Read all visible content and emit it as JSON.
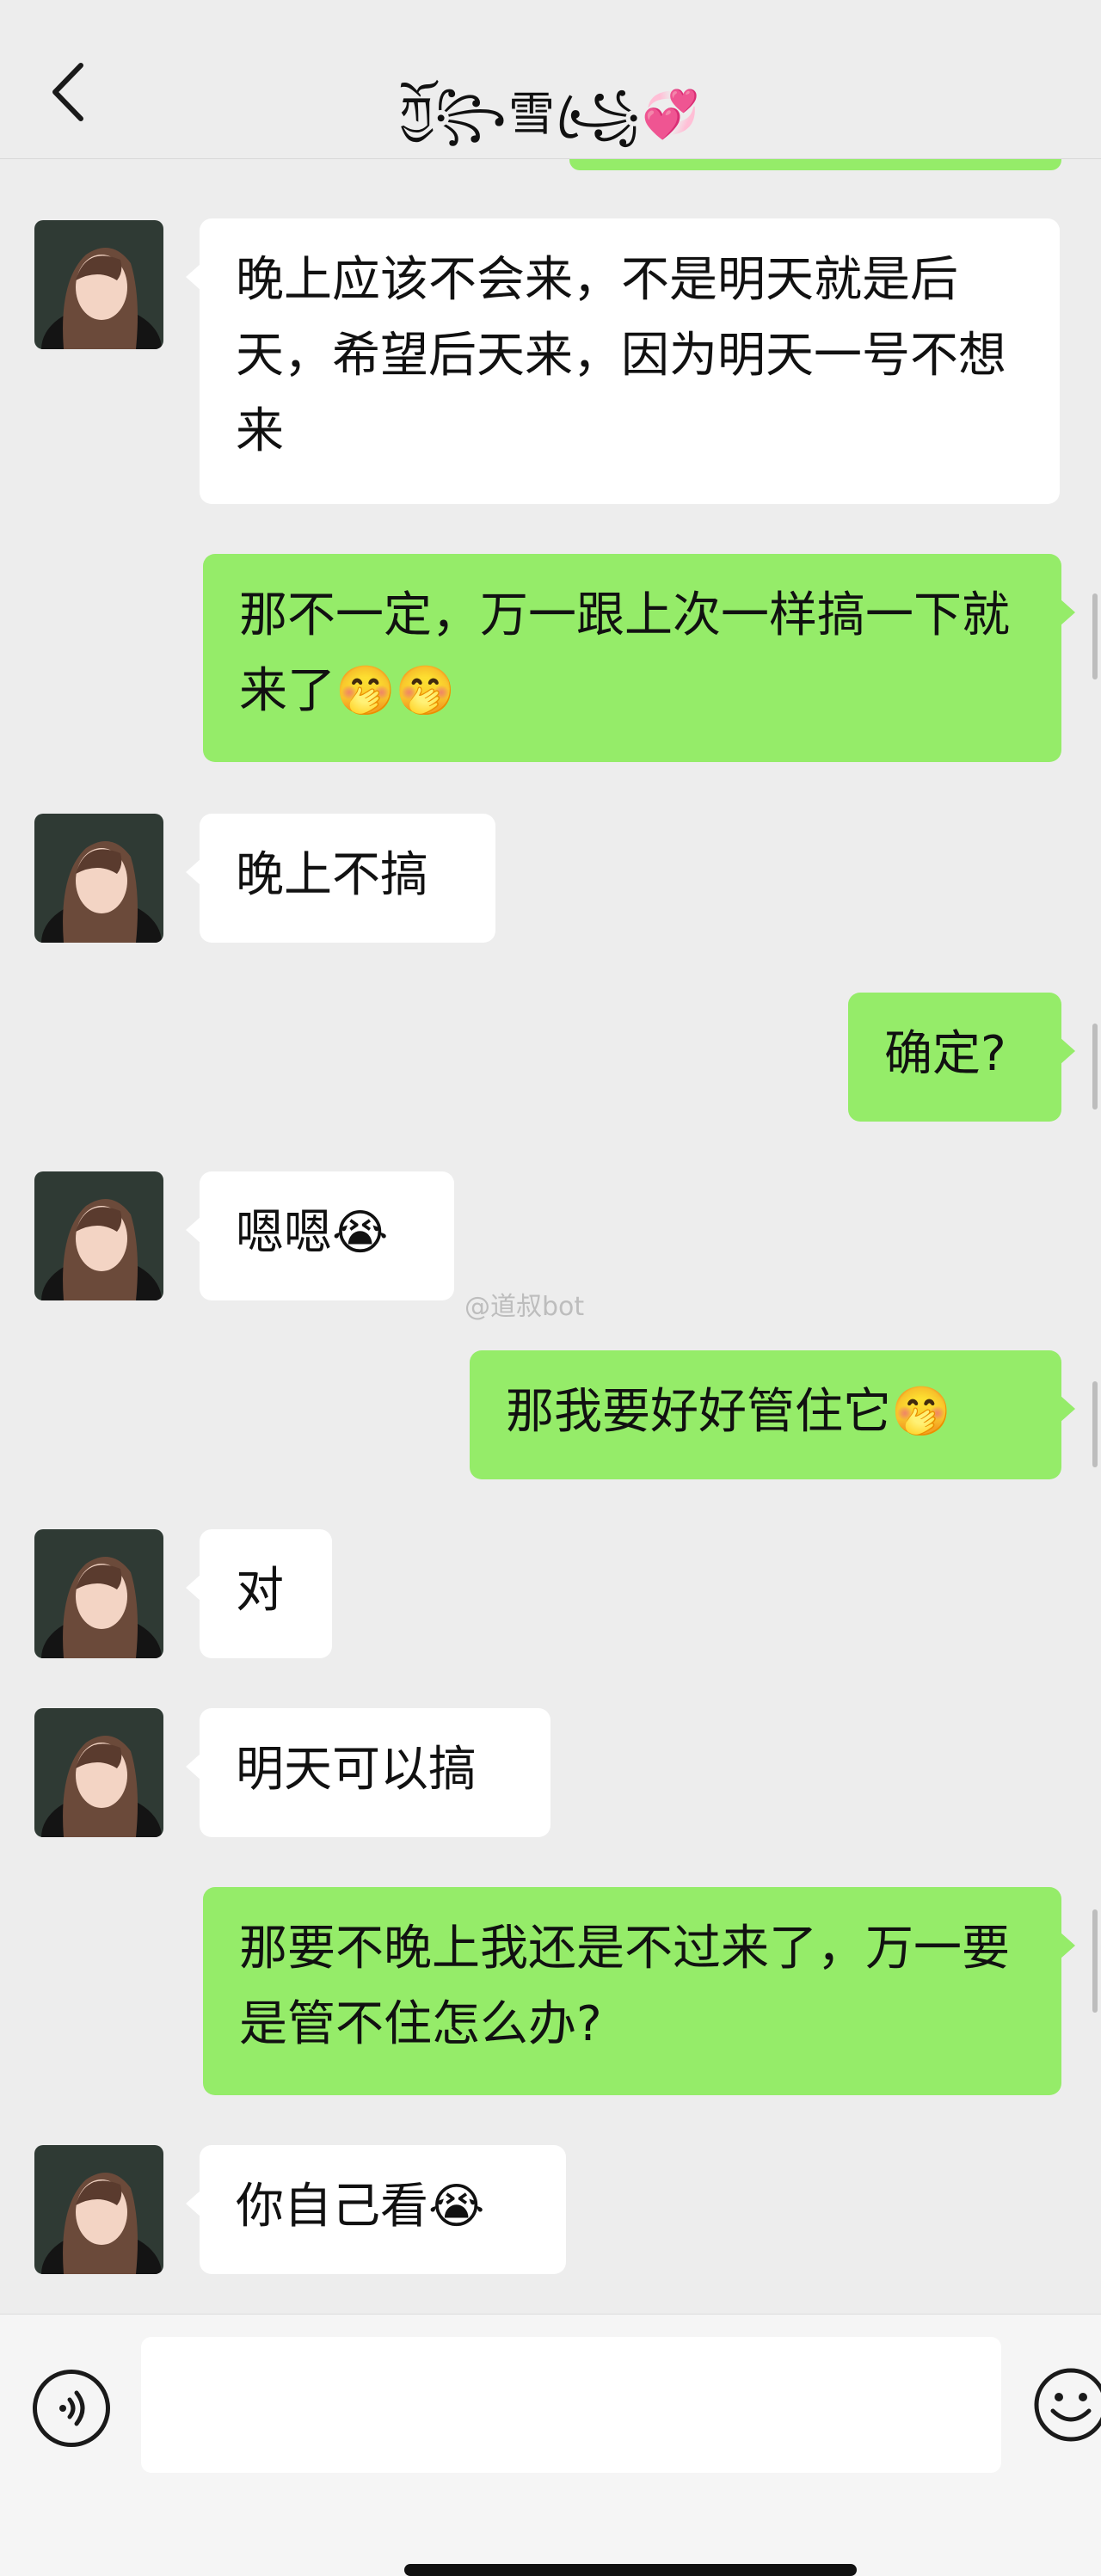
{
  "header": {
    "title": "ཀྱོ꧂雪꧁ꦿ💞"
  },
  "messages": [
    {
      "side": "left",
      "text": "晚上应该不会来，不是明天就是后天，希望后天来，因为明天一号不想来"
    },
    {
      "side": "right",
      "text": "那不一定，万一跟上次一样搞一下就来了🤭🤭"
    },
    {
      "side": "left",
      "text": "晚上不搞"
    },
    {
      "side": "right",
      "text": "确定?"
    },
    {
      "side": "left",
      "text": "嗯嗯😭"
    },
    {
      "side": "right",
      "text": "那我要好好管住它🤭"
    },
    {
      "side": "left",
      "text": "对"
    },
    {
      "side": "left",
      "text": "明天可以搞"
    },
    {
      "side": "right",
      "text": "那要不晚上我还是不过来了，万一要是管不住怎么办?"
    },
    {
      "side": "left",
      "text": "你自己看😭"
    }
  ],
  "watermark": "@道叔bot",
  "icons": {
    "back": "back-chevron-icon",
    "voice": "voice-input-icon",
    "emoji": "emoji-smile-icon"
  },
  "colors": {
    "background": "#ededed",
    "sent_bubble": "#95ec69",
    "received_bubble": "#ffffff"
  }
}
